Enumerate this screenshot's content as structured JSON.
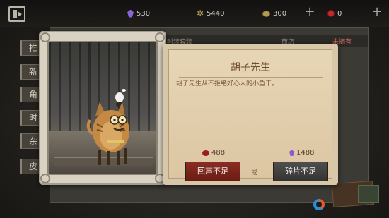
{
  "currencies": {
    "clue_purple": "530",
    "fragments": "5440",
    "coins": "300",
    "echoes": "0"
  },
  "side_tabs": [
    "推",
    "新",
    "角",
    "时",
    "杂",
    "皮"
  ],
  "bg_tabs": [
    "时装套装",
    "商店",
    "未拥有"
  ],
  "item": {
    "name": "胡子先生",
    "description": "胡子先生从不拒绝好心人的小鱼干。",
    "price_echo": "488",
    "price_fragment": "1488",
    "or_label": "或",
    "buy_echo_label": "回声不足",
    "buy_fragment_label": "碎片不足"
  },
  "colors": {
    "echo_button": "#7a241b",
    "fragment_button": "#434341",
    "card_parchment": "#e2cfad",
    "purple_gem": "#8b63d8",
    "red_bead": "#c42a2a"
  },
  "icons": [
    "back-icon",
    "purple-gem-icon",
    "fragment-flake-icon",
    "coin-icon",
    "red-bead-icon",
    "plus-icon"
  ]
}
